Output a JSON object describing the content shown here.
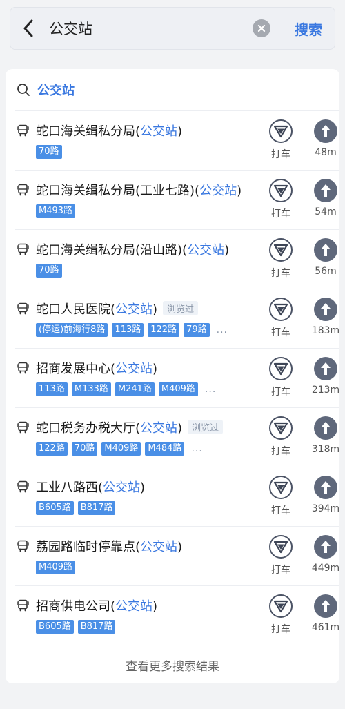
{
  "search": {
    "query": "公交站",
    "button_label": "搜索"
  },
  "suggestion": {
    "text": "公交站"
  },
  "results": [
    {
      "name_prefix": "蛇口海关缉私分局(",
      "name_highlight": "公交站",
      "name_suffix": ")",
      "viewed": "",
      "tags": [
        "70路"
      ],
      "more": "",
      "taxi_label": "打车",
      "distance": "48m"
    },
    {
      "name_prefix": "蛇口海关缉私分局(工业七路)(",
      "name_highlight": "公交站",
      "name_suffix": ")",
      "viewed": "",
      "tags": [
        "M493路"
      ],
      "more": "",
      "taxi_label": "打车",
      "distance": "54m"
    },
    {
      "name_prefix": "蛇口海关缉私分局(沿山路)(",
      "name_highlight": "公交站",
      "name_suffix": ")",
      "viewed": "",
      "tags": [
        "70路"
      ],
      "more": "",
      "taxi_label": "打车",
      "distance": "56m"
    },
    {
      "name_prefix": "蛇口人民医院(",
      "name_highlight": "公交站",
      "name_suffix": ")",
      "viewed": "浏览过",
      "tags": [
        "(停运)前海行8路",
        "113路",
        "122路",
        "79路"
      ],
      "more": "...",
      "taxi_label": "打车",
      "distance": "183m"
    },
    {
      "name_prefix": "招商发展中心(",
      "name_highlight": "公交站",
      "name_suffix": ")",
      "viewed": "",
      "tags": [
        "113路",
        "M133路",
        "M241路",
        "M409路"
      ],
      "more": "...",
      "taxi_label": "打车",
      "distance": "213m"
    },
    {
      "name_prefix": "蛇口税务办税大厅(",
      "name_highlight": "公交站",
      "name_suffix": ")",
      "viewed": "浏览过",
      "tags": [
        "122路",
        "70路",
        "M409路",
        "M484路"
      ],
      "more": "...",
      "taxi_label": "打车",
      "distance": "318m"
    },
    {
      "name_prefix": "工业八路西(",
      "name_highlight": "公交站",
      "name_suffix": ")",
      "viewed": "",
      "tags": [
        "B605路",
        "B817路"
      ],
      "more": "",
      "taxi_label": "打车",
      "distance": "394m"
    },
    {
      "name_prefix": "荔园路临时停靠点(",
      "name_highlight": "公交站",
      "name_suffix": ")",
      "viewed": "",
      "tags": [
        "M409路"
      ],
      "more": "",
      "taxi_label": "打车",
      "distance": "449m"
    },
    {
      "name_prefix": "招商供电公司(",
      "name_highlight": "公交站",
      "name_suffix": ")",
      "viewed": "",
      "tags": [
        "B605路",
        "B817路"
      ],
      "more": "",
      "taxi_label": "打车",
      "distance": "461m"
    }
  ],
  "footer": {
    "more_results_label": "查看更多搜索结果"
  },
  "colors": {
    "accent": "#3a78e0",
    "tag_bg": "#4a8fe6",
    "nav_bg": "#5f687b"
  },
  "icons": [
    "back-arrow-icon",
    "clear-icon",
    "search-icon",
    "bus-icon",
    "taxi-icon",
    "navigation-arrow-icon"
  ]
}
